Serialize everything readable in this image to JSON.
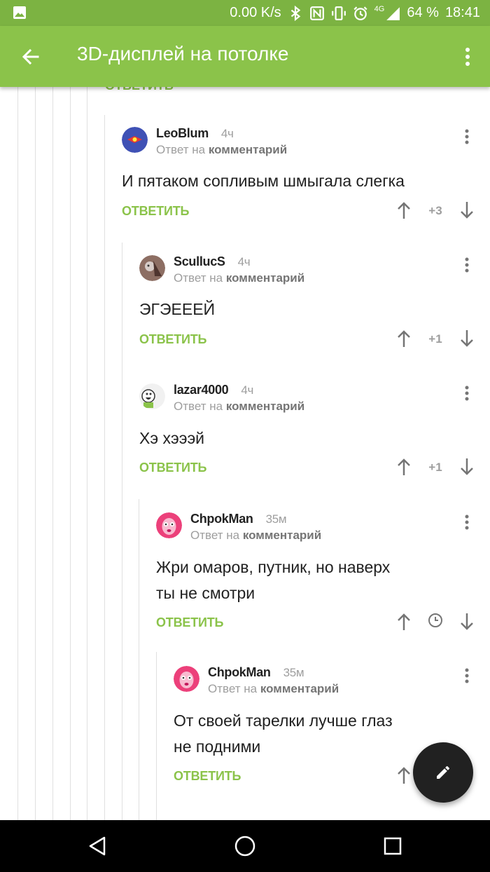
{
  "status_bar": {
    "speed": "0.00 K/s",
    "network": "4G",
    "battery": "64 %",
    "time": "18:41",
    "icons": [
      "image-icon",
      "bluetooth-icon",
      "nfc-icon",
      "vibrate-icon",
      "alarm-icon",
      "signal-icon"
    ]
  },
  "app_bar": {
    "title": "3D-дисплей на потолке",
    "back_icon": "back-arrow-icon",
    "menu_icon": "more-vert-icon"
  },
  "accent_color": "#8bc34a",
  "reply_label": "ОТВЕТИТЬ",
  "reply_to_prefix": "Ответ на",
  "reply_to_target": "комментарий",
  "comments": [
    {
      "author": "LeoBlum",
      "time": "4ч",
      "reply_prefix": "Ответ на",
      "reply_target": "комментарий",
      "text": [
        "И пятаком сопливым шмыгала слегка"
      ],
      "reply_label": "ОТВЕТИТЬ",
      "score": "+3"
    },
    {
      "author": "ScullucS",
      "time": "4ч",
      "reply_prefix": "Ответ на",
      "reply_target": "комментарий",
      "text": [
        "ЭГЭЕЕЕЙ"
      ],
      "reply_label": "ОТВЕТИТЬ",
      "score": "+1"
    },
    {
      "author": "lazar4000",
      "time": "4ч",
      "reply_prefix": "Ответ на",
      "reply_target": "комментарий",
      "text": [
        "Хэ хэээй"
      ],
      "reply_label": "ОТВЕТИТЬ",
      "score": "+1"
    },
    {
      "author": "ChpokMan",
      "time": "35м",
      "reply_prefix": "Ответ на",
      "reply_target": "комментарий",
      "text": [
        "Жри омаров, путник, но наверх",
        "ты не смотри"
      ],
      "reply_label": "ОТВЕТИТЬ",
      "score_icon": "clock-icon"
    },
    {
      "author": "ChpokMan",
      "time": "35м",
      "reply_prefix": "Ответ на",
      "reply_target": "комментарий",
      "text": [
        "От своей тарелки лучше глаз",
        "не подними"
      ],
      "reply_label": "ОТВЕТИТЬ"
    }
  ],
  "fab": {
    "icon": "edit-pencil-icon"
  },
  "nav_bar": {
    "icons": [
      "nav-back-icon",
      "nav-home-icon",
      "nav-recents-icon"
    ]
  }
}
